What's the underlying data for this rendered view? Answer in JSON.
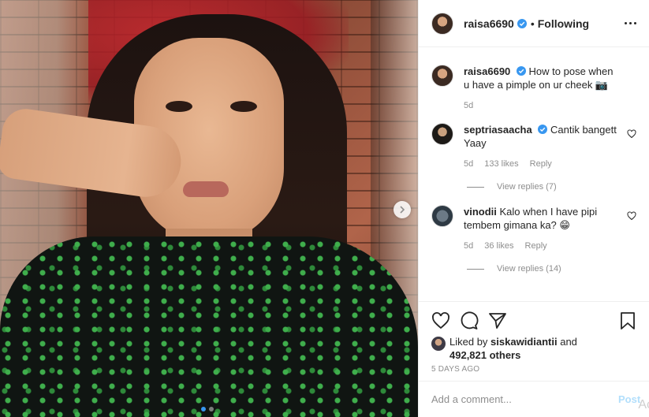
{
  "colors": {
    "accent": "#3897f0",
    "verified": "#3897f0",
    "muted": "#8e8e8e",
    "border": "#efefef"
  },
  "photo": {
    "carousel_dots": 2,
    "active_dot": 1,
    "next_icon": "chevron-right-icon"
  },
  "header": {
    "username": "raisa6690",
    "verified_icon": "verified-badge-icon",
    "separator": "•",
    "follow_state": "Following",
    "more_icon": "more-horizontal-icon"
  },
  "caption": {
    "username": "raisa6690",
    "text": "How to pose when u have a pimple on ur cheek 📷",
    "time": "5d"
  },
  "comments": [
    {
      "username": "septriasaacha",
      "verified": true,
      "text": "Cantik bangett Yaay",
      "time": "5d",
      "likes": "133 likes",
      "reply_label": "Reply",
      "view_replies": "View replies (7)"
    },
    {
      "username": "vinodii",
      "verified": false,
      "text": "Kalo when I have pipi tembem gimana ka? 😁",
      "time": "5d",
      "likes": "36 likes",
      "reply_label": "Reply",
      "view_replies": "View replies (14)"
    }
  ],
  "actions": {
    "like_icon": "heart-icon",
    "comment_icon": "comment-icon",
    "share_icon": "paper-plane-icon",
    "save_icon": "bookmark-icon"
  },
  "likes": {
    "prefix": "Liked by",
    "user": "siskawidiantii",
    "joiner": "and",
    "count": "492,821 others"
  },
  "timestamp": "5 DAYS AGO",
  "add_comment": {
    "placeholder": "Add a comment...",
    "post_label": "Post"
  },
  "watermark": "Ac"
}
